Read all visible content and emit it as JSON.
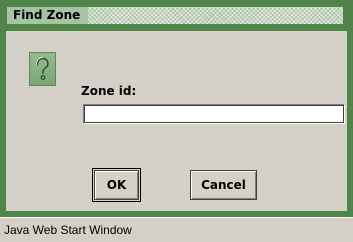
{
  "window": {
    "title": "Find Zone",
    "accent_color": "#4f8548",
    "status_text": "Java Web Start Window"
  },
  "dialog": {
    "icon": "question-icon",
    "label": "Zone id:",
    "input_value": "",
    "input_placeholder": ""
  },
  "buttons": {
    "ok_label": "OK",
    "cancel_label": "Cancel"
  }
}
